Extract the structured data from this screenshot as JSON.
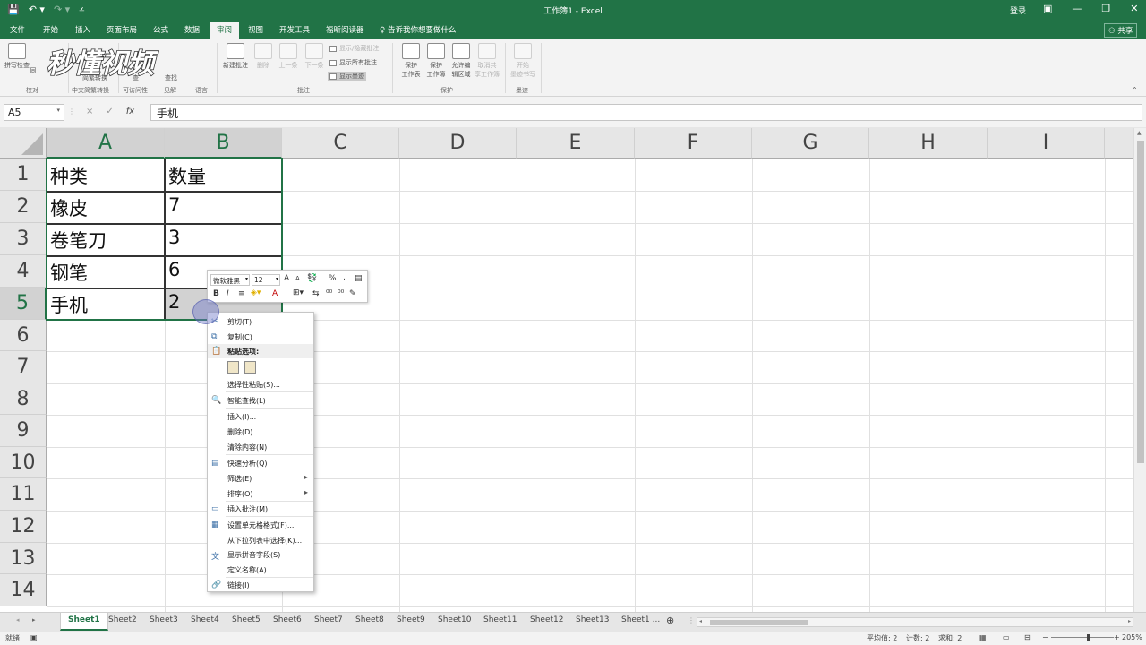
{
  "window": {
    "title": "工作簿1 - Excel",
    "login": "登录",
    "buttons": [
      "ribbon-display-options",
      "minimize",
      "restore",
      "close"
    ]
  },
  "tabs": [
    {
      "label": "文件",
      "active": false
    },
    {
      "label": "开始",
      "active": false
    },
    {
      "label": "插入",
      "active": false
    },
    {
      "label": "页面布局",
      "active": false
    },
    {
      "label": "公式",
      "active": false
    },
    {
      "label": "数据",
      "active": false
    },
    {
      "label": "审阅",
      "active": true
    },
    {
      "label": "视图",
      "active": false
    },
    {
      "label": "开发工具",
      "active": false
    },
    {
      "label": "福昕阅读器",
      "active": false
    }
  ],
  "tell_me": "告诉我你想要做什么",
  "share": "共享",
  "ribbon": {
    "groups": {
      "proofing": "校对",
      "chinese": "中文简繁转换",
      "accessibility": "可访问性",
      "insights": "见解",
      "language": "语言",
      "comments": "批注",
      "protect": "保护",
      "ink": "墨迹"
    },
    "buttons": {
      "spell": "拼写检查",
      "thesaurus": "同",
      "convert": "简繁转换",
      "check": "查",
      "lookup": "查找",
      "new_comment": "新建批注",
      "delete": "删除",
      "previous": "上一条",
      "next": "下一条",
      "show_hide_comment": "显示/隐藏批注",
      "show_all_comments": "显示所有批注",
      "show_ink": "显示墨迹",
      "protect_sheet_1": "保护",
      "protect_sheet_2": "工作表",
      "protect_wb_1": "保护",
      "protect_wb_2": "工作簿",
      "allow_edit_1": "允许编",
      "allow_edit_2": "辑区域",
      "unshare_1": "取消共",
      "unshare_2": "享工作簿",
      "ink_1": "开始",
      "ink_2": "墨迹书写"
    }
  },
  "watermark": "秒懂视频",
  "formula_bar": {
    "name_box": "A5",
    "icons": [
      "×",
      "✓",
      "fx"
    ],
    "content": "手机"
  },
  "grid": {
    "columns": [
      "A",
      "B",
      "C",
      "D",
      "E",
      "F",
      "G",
      "H",
      "I"
    ],
    "rows": [
      "1",
      "2",
      "3",
      "4",
      "5",
      "6",
      "7",
      "8",
      "9",
      "10",
      "11",
      "12",
      "13",
      "14"
    ],
    "table": [
      [
        "种类",
        "数量"
      ],
      [
        "橡皮",
        "7"
      ],
      [
        "卷笔刀",
        "3"
      ],
      [
        "钢笔",
        "6"
      ],
      [
        "手机",
        "2"
      ]
    ]
  },
  "mini_toolbar": {
    "font": "微软雅黑",
    "size": "12",
    "buttons": [
      "A",
      "A",
      "%",
      ",",
      "B",
      "I",
      "A"
    ]
  },
  "context_menu": {
    "items": {
      "cut": "剪切(T)",
      "copy": "复制(C)",
      "paste_options": "粘贴选项:",
      "paste_special": "选择性粘贴(S)...",
      "smart_lookup": "智能查找(L)",
      "insert": "插入(I)...",
      "delete": "删除(D)...",
      "clear": "清除内容(N)",
      "quick_analysis": "快速分析(Q)",
      "filter": "筛选(E)",
      "sort": "排序(O)",
      "insert_comment": "插入批注(M)",
      "format_cells": "设置单元格格式(F)...",
      "pick_list": "从下拉列表中选择(K)...",
      "phonetic": "显示拼音字段(S)",
      "define_name": "定义名称(A)...",
      "link": "链接(I)"
    }
  },
  "sheets": {
    "tabs": [
      "Sheet1",
      "Sheet2",
      "Sheet3",
      "Sheet4",
      "Sheet5",
      "Sheet6",
      "Sheet7",
      "Sheet8",
      "Sheet9",
      "Sheet10",
      "Sheet11",
      "Sheet12",
      "Sheet13",
      "Sheet1 ..."
    ],
    "active": "Sheet1",
    "add": "⊕"
  },
  "status": {
    "mode": "就绪",
    "average": "平均值: 2",
    "count": "计数: 2",
    "sum": "求和: 2",
    "zoom": "205%"
  }
}
